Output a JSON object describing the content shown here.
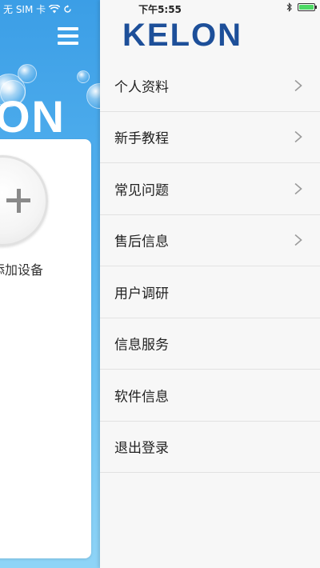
{
  "status_bar": {
    "carrier": "无 SIM 卡",
    "time": "下午5:55"
  },
  "background_screen": {
    "logo_fragment": "ON",
    "add_device_label": "添加设备"
  },
  "drawer": {
    "logo": "KELON",
    "menu_items": [
      {
        "label": "个人资料",
        "has_chevron": true
      },
      {
        "label": "新手教程",
        "has_chevron": true
      },
      {
        "label": "常见问题",
        "has_chevron": true
      },
      {
        "label": "售后信息",
        "has_chevron": true
      },
      {
        "label": "用户调研",
        "has_chevron": false
      },
      {
        "label": "信息服务",
        "has_chevron": false
      },
      {
        "label": "软件信息",
        "has_chevron": false
      },
      {
        "label": "退出登录",
        "has_chevron": false
      }
    ]
  },
  "colors": {
    "brand": "#1d4f99",
    "bg_blue": "#4aa9ec",
    "battery": "#4cd964"
  },
  "icons": [
    "hamburger-menu-icon",
    "wifi-icon",
    "sync-icon",
    "bluetooth-icon",
    "battery-icon",
    "plus-icon",
    "chevron-right-icon"
  ]
}
